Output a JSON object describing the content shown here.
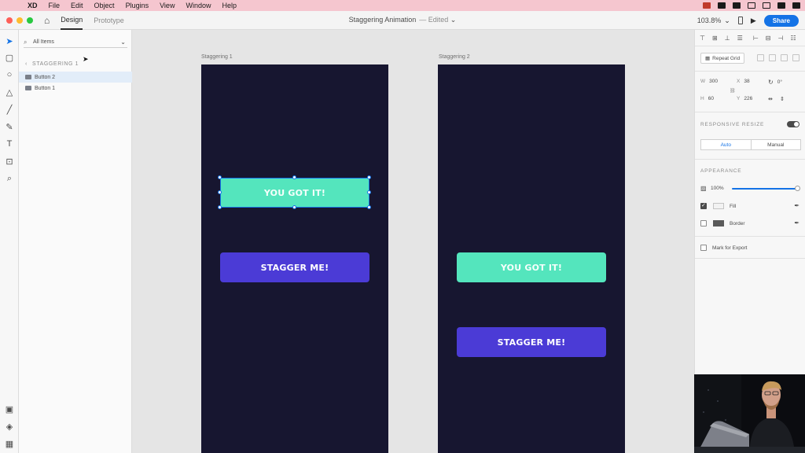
{
  "menubar": {
    "apple_icon": "apple-icon",
    "app_name": "XD",
    "items": [
      "File",
      "Edit",
      "Object",
      "Plugins",
      "View",
      "Window",
      "Help"
    ]
  },
  "titlebar": {
    "tabs": [
      "Design",
      "Prototype"
    ],
    "active_tab": "Design",
    "document_title": "Staggering Animation",
    "status": "— Edited",
    "zoom": "103.8%",
    "share_label": "Share"
  },
  "layers": {
    "search_placeholder": "All Items",
    "breadcrumb": "STAGGERING 1",
    "items": [
      {
        "label": "Button 2",
        "selected": true
      },
      {
        "label": "Button 1",
        "selected": false
      }
    ]
  },
  "canvas": {
    "artboards": [
      {
        "label": "Staggering 1",
        "buttons": [
          {
            "label": "YOU GOT IT!",
            "style": "green"
          },
          {
            "label": "STAGGER ME!",
            "style": "purple"
          }
        ]
      },
      {
        "label": "Staggering 2",
        "buttons": [
          {
            "label": "YOU GOT IT!",
            "style": "green"
          },
          {
            "label": "STAGGER ME!",
            "style": "purple"
          }
        ]
      }
    ]
  },
  "props": {
    "repeat_grid_label": "Repeat Grid",
    "w_label": "W",
    "w_value": "300",
    "h_label": "H",
    "h_value": "60",
    "x_label": "X",
    "x_value": "38",
    "y_label": "Y",
    "y_value": "226",
    "rotation_value": "0°",
    "responsive_resize_label": "RESPONSIVE RESIZE",
    "responsive_resize_on": true,
    "resize_modes": [
      "Auto",
      "Manual"
    ],
    "appearance_label": "APPEARANCE",
    "opacity_value": "100%",
    "fill_label": "Fill",
    "fill_checked": true,
    "border_label": "Border",
    "border_checked": false,
    "export_label": "Mark for Export"
  },
  "colors": {
    "accent": "#1473e6",
    "artboard_bg": "#171630",
    "button_green": "#54e5bd",
    "button_purple": "#4b3bd6",
    "menubar_bg": "#f5c6cf"
  }
}
